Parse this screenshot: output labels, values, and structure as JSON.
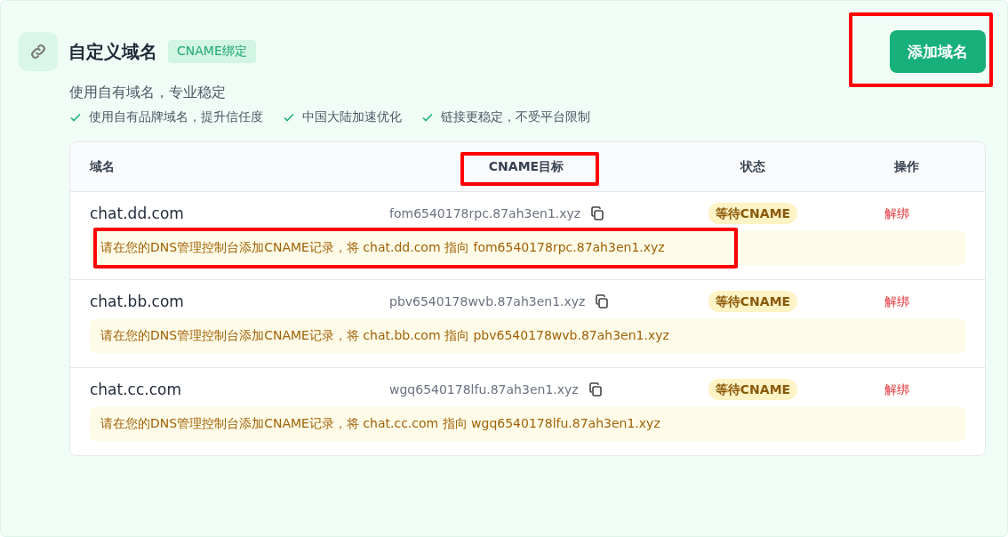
{
  "header": {
    "title": "自定义域名",
    "badge": "CNAME绑定",
    "subtitle": "使用自有域名，专业稳定",
    "features": [
      "使用自有品牌域名，提升信任度",
      "中国大陆加速优化",
      "链接更稳定，不受平台限制"
    ]
  },
  "add_button": {
    "label": "添加域名",
    "highlighted": true
  },
  "table": {
    "columns": [
      {
        "label": "域名",
        "highlighted": false
      },
      {
        "label": "CNAME目标",
        "highlighted": true
      },
      {
        "label": "状态",
        "highlighted": false
      },
      {
        "label": "操作",
        "highlighted": false
      }
    ],
    "rows": [
      {
        "domain": "chat.dd.com",
        "target": "fom6540178rpc.87ah3en1.xyz",
        "status": "等待CNAME",
        "action": "解绑",
        "hint": "请在您的DNS管理控制台添加CNAME记录，将 chat.dd.com 指向 fom6540178rpc.87ah3en1.xyz",
        "hint_highlighted": true
      },
      {
        "domain": "chat.bb.com",
        "target": "pbv6540178wvb.87ah3en1.xyz",
        "status": "等待CNAME",
        "action": "解绑",
        "hint": "请在您的DNS管理控制台添加CNAME记录，将 chat.bb.com 指向 pbv6540178wvb.87ah3en1.xyz",
        "hint_highlighted": false
      },
      {
        "domain": "chat.cc.com",
        "target": "wgq6540178lfu.87ah3en1.xyz",
        "status": "等待CNAME",
        "action": "解绑",
        "hint": "请在您的DNS管理控制台添加CNAME记录，将 chat.cc.com 指向 wgq6540178lfu.87ah3en1.xyz",
        "hint_highlighted": false
      }
    ]
  }
}
